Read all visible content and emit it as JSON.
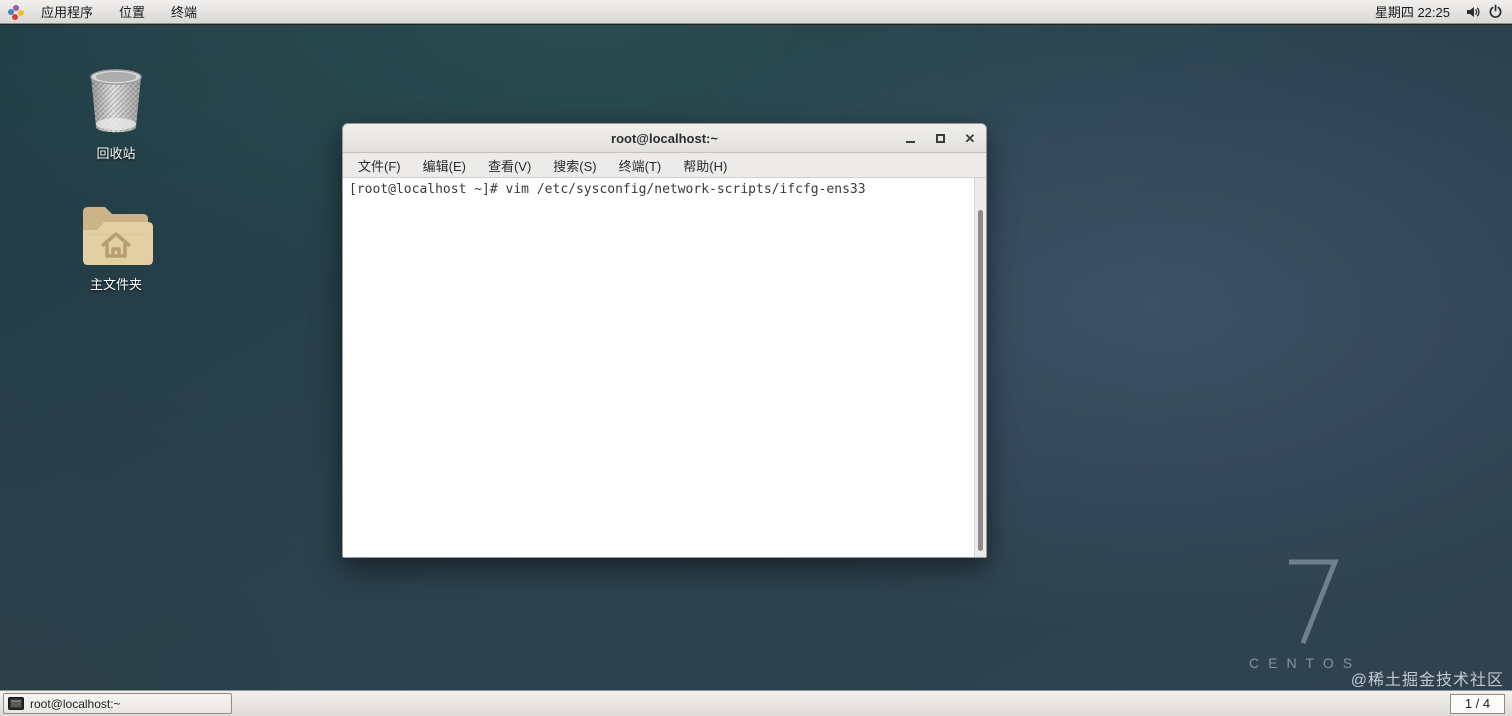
{
  "top_panel": {
    "menus": [
      {
        "label": "应用程序"
      },
      {
        "label": "位置"
      },
      {
        "label": "终端"
      }
    ],
    "clock": "星期四 22:25",
    "icons": {
      "applications-icon": "four-color-dots",
      "volume-icon": "speaker-with-waves",
      "power-icon": "power-symbol"
    }
  },
  "desktop": {
    "icons": [
      {
        "label": "回收站",
        "icon": "trash-basket"
      },
      {
        "label": "主文件夹",
        "icon": "home-folder"
      }
    ],
    "centos_numeral": "7",
    "centos_name": "CENTOS",
    "community_watermark": "@稀土掘金技术社区"
  },
  "terminal_window": {
    "title": "root@localhost:~",
    "window_controls": {
      "minimize": "minimize-bar",
      "maximize": "square-outline",
      "close": "✕"
    },
    "menu_items": [
      "文件(F)",
      "编辑(E)",
      "查看(V)",
      "搜索(S)",
      "终端(T)",
      "帮助(H)"
    ],
    "prompt_line": "[root@localhost ~]# vim /etc/sysconfig/network-scripts/ifcfg-ens33"
  },
  "taskbar": {
    "active_task": "root@localhost:~",
    "workspace_indicator": "1 / 4",
    "icons": {
      "terminal-task-icon": "mini-terminal"
    }
  },
  "colors": {
    "panel_bg": "#e6e4e1",
    "desktop_teal": "#2a4a4e",
    "desktop_blue": "#3d4f66",
    "desktop_slate": "#2e404c",
    "terminal_bg": "#ffffff",
    "watermark_gray": "#8997a4"
  }
}
